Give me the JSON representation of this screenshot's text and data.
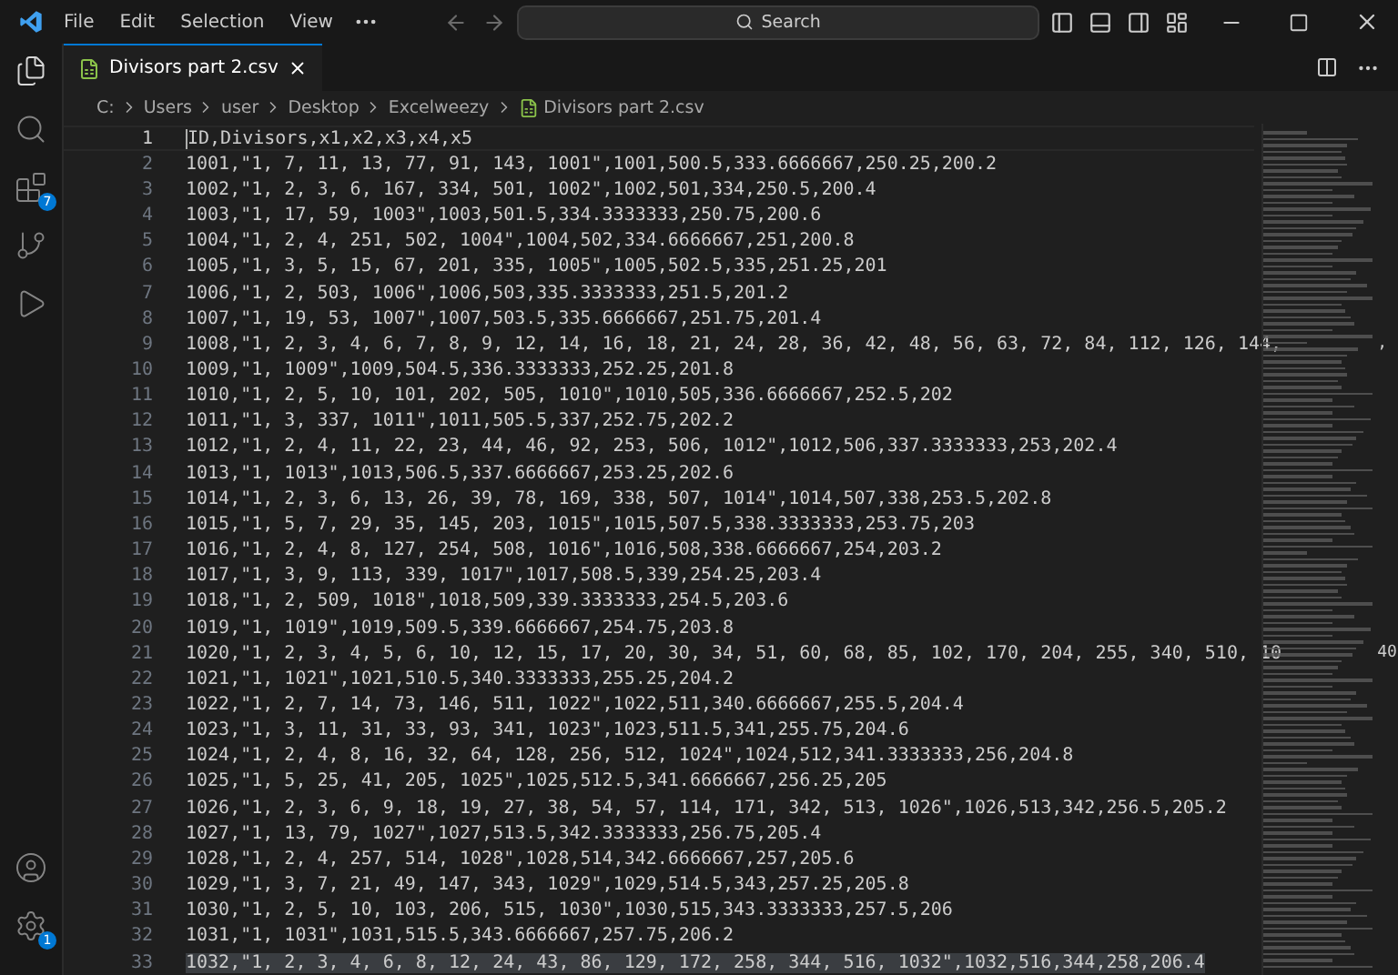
{
  "menu": [
    "File",
    "Edit",
    "Selection",
    "View"
  ],
  "command_center": {
    "placeholder": "Search"
  },
  "activity_bar": [
    {
      "kind": "files"
    },
    {
      "kind": "search"
    },
    {
      "kind": "extensions",
      "badge": "7"
    },
    {
      "kind": "source-control"
    },
    {
      "kind": "run-debug"
    }
  ],
  "activity_bar_bottom": [
    {
      "kind": "account"
    },
    {
      "kind": "settings",
      "badge": "1"
    }
  ],
  "tabs": [
    {
      "label": "Divisors part 2.csv",
      "selected": true
    }
  ],
  "breadcrumb": [
    "C:",
    "Users",
    "user",
    "Desktop",
    "Excelweezy",
    "Divisors part 2.csv"
  ],
  "lines": [
    {
      "number": "1",
      "text": "ID,Divisors,x1,x2,x3,x4,x5",
      "current": true,
      "highlighted": false
    },
    {
      "number": "2",
      "text": "1001,\"1, 7, 11, 13, 77, 91, 143, 1001\",1001,500.5,333.6666667,250.25,200.2",
      "current": false,
      "highlighted": false
    },
    {
      "number": "3",
      "text": "1002,\"1, 2, 3, 6, 167, 334, 501, 1002\",1002,501,334,250.5,200.4",
      "current": false,
      "highlighted": false
    },
    {
      "number": "4",
      "text": "1003,\"1, 17, 59, 1003\",1003,501.5,334.3333333,250.75,200.6",
      "current": false,
      "highlighted": false
    },
    {
      "number": "5",
      "text": "1004,\"1, 2, 4, 251, 502, 1004\",1004,502,334.6666667,251,200.8",
      "current": false,
      "highlighted": false
    },
    {
      "number": "6",
      "text": "1005,\"1, 3, 5, 15, 67, 201, 335, 1005\",1005,502.5,335,251.25,201",
      "current": false,
      "highlighted": false
    },
    {
      "number": "7",
      "text": "1006,\"1, 2, 503, 1006\",1006,503,335.3333333,251.5,201.2",
      "current": false,
      "highlighted": false
    },
    {
      "number": "8",
      "text": "1007,\"1, 19, 53, 1007\",1007,503.5,335.6666667,251.75,201.4",
      "current": false,
      "highlighted": false
    },
    {
      "number": "9",
      "text": "1008,\"1, 2, 3, 4, 6, 7, 8, 9, 12, 14, 16, 18, 21, 24, 28, 36, 42, 48, 56, 63, 72, 84, 112, 126, 144,",
      "overflow": ",",
      "current": false,
      "highlighted": false
    },
    {
      "number": "10",
      "text": "1009,\"1, 1009\",1009,504.5,336.3333333,252.25,201.8",
      "current": false,
      "highlighted": false
    },
    {
      "number": "11",
      "text": "1010,\"1, 2, 5, 10, 101, 202, 505, 1010\",1010,505,336.6666667,252.5,202",
      "current": false,
      "highlighted": false
    },
    {
      "number": "12",
      "text": "1011,\"1, 3, 337, 1011\",1011,505.5,337,252.75,202.2",
      "current": false,
      "highlighted": false
    },
    {
      "number": "13",
      "text": "1012,\"1, 2, 4, 11, 22, 23, 44, 46, 92, 253, 506, 1012\",1012,506,337.3333333,253,202.4",
      "current": false,
      "highlighted": false
    },
    {
      "number": "14",
      "text": "1013,\"1, 1013\",1013,506.5,337.6666667,253.25,202.6",
      "current": false,
      "highlighted": false
    },
    {
      "number": "15",
      "text": "1014,\"1, 2, 3, 6, 13, 26, 39, 78, 169, 338, 507, 1014\",1014,507,338,253.5,202.8",
      "current": false,
      "highlighted": false
    },
    {
      "number": "16",
      "text": "1015,\"1, 5, 7, 29, 35, 145, 203, 1015\",1015,507.5,338.3333333,253.75,203",
      "current": false,
      "highlighted": false
    },
    {
      "number": "17",
      "text": "1016,\"1, 2, 4, 8, 127, 254, 508, 1016\",1016,508,338.6666667,254,203.2",
      "current": false,
      "highlighted": false
    },
    {
      "number": "18",
      "text": "1017,\"1, 3, 9, 113, 339, 1017\",1017,508.5,339,254.25,203.4",
      "current": false,
      "highlighted": false
    },
    {
      "number": "19",
      "text": "1018,\"1, 2, 509, 1018\",1018,509,339.3333333,254.5,203.6",
      "current": false,
      "highlighted": false
    },
    {
      "number": "20",
      "text": "1019,\"1, 1019\",1019,509.5,339.6666667,254.75,203.8",
      "current": false,
      "highlighted": false
    },
    {
      "number": "21",
      "text": "1020,\"1, 2, 3, 4, 5, 6, 10, 12, 15, 17, 20, 30, 34, 51, 60, 68, 85, 102, 170, 204, 255, 340, 510, 10",
      "overflow": "40",
      "current": false,
      "highlighted": false
    },
    {
      "number": "22",
      "text": "1021,\"1, 1021\",1021,510.5,340.3333333,255.25,204.2",
      "current": false,
      "highlighted": false
    },
    {
      "number": "23",
      "text": "1022,\"1, 2, 7, 14, 73, 146, 511, 1022\",1022,511,340.6666667,255.5,204.4",
      "current": false,
      "highlighted": false
    },
    {
      "number": "24",
      "text": "1023,\"1, 3, 11, 31, 33, 93, 341, 1023\",1023,511.5,341,255.75,204.6",
      "current": false,
      "highlighted": false
    },
    {
      "number": "25",
      "text": "1024,\"1, 2, 4, 8, 16, 32, 64, 128, 256, 512, 1024\",1024,512,341.3333333,256,204.8",
      "current": false,
      "highlighted": false
    },
    {
      "number": "26",
      "text": "1025,\"1, 5, 25, 41, 205, 1025\",1025,512.5,341.6666667,256.25,205",
      "current": false,
      "highlighted": false
    },
    {
      "number": "27",
      "text": "1026,\"1, 2, 3, 6, 9, 18, 19, 27, 38, 54, 57, 114, 171, 342, 513, 1026\",1026,513,342,256.5,205.2",
      "current": false,
      "highlighted": false
    },
    {
      "number": "28",
      "text": "1027,\"1, 13, 79, 1027\",1027,513.5,342.3333333,256.75,205.4",
      "current": false,
      "highlighted": false
    },
    {
      "number": "29",
      "text": "1028,\"1, 2, 4, 257, 514, 1028\",1028,514,342.6666667,257,205.6",
      "current": false,
      "highlighted": false
    },
    {
      "number": "30",
      "text": "1029,\"1, 3, 7, 21, 49, 147, 343, 1029\",1029,514.5,343,257.25,205.8",
      "current": false,
      "highlighted": false
    },
    {
      "number": "31",
      "text": "1030,\"1, 2, 5, 10, 103, 206, 515, 1030\",1030,515,343.3333333,257.5,206",
      "current": false,
      "highlighted": false
    },
    {
      "number": "32",
      "text": "1031,\"1, 1031\",1031,515.5,343.6666667,257.75,206.2",
      "current": false,
      "highlighted": false
    },
    {
      "number": "33",
      "text": "1032,\"1, 2, 3, 4, 6, 8, 12, 24, 43, 86, 129, 172, 258, 344, 516, 1032\",1032,516,344,258,206.4",
      "current": false,
      "highlighted": true
    }
  ]
}
